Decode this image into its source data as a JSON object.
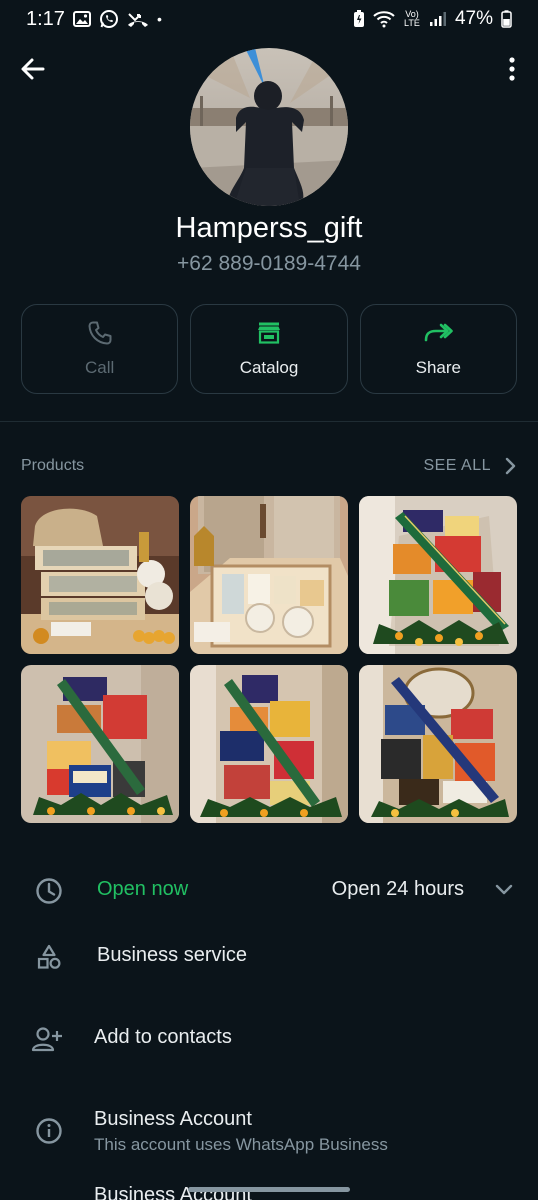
{
  "status_bar": {
    "time": "1:17",
    "dot": "•",
    "battery": "47%",
    "icons_left": [
      "gallery-icon",
      "whatsapp-icon",
      "missed-call-icon"
    ],
    "icons_right": [
      "battery-saver-icon",
      "wifi-icon",
      "volte-icon",
      "signal-icon",
      "battery-icon"
    ],
    "volte_text": "Vo) LTE"
  },
  "profile": {
    "name": "Hamperss_gift",
    "phone": "+62 889-0189-4744"
  },
  "actions": [
    {
      "label": "Call",
      "icon": "phone-icon",
      "enabled": false
    },
    {
      "label": "Catalog",
      "icon": "store-icon",
      "enabled": true
    },
    {
      "label": "Share",
      "icon": "share-icon",
      "enabled": true
    }
  ],
  "products": {
    "title": "Products",
    "see_all": "SEE ALL",
    "items": [
      {
        "image": "wooden-drawer-hamper"
      },
      {
        "image": "boxed-cup-set-hamper"
      },
      {
        "image": "snack-hamper-choco-ribbon"
      },
      {
        "image": "snack-hamper-foxs"
      },
      {
        "image": "snack-hamper-royal-tango"
      },
      {
        "image": "snack-hamper-tin-tango"
      }
    ]
  },
  "info": {
    "open_now": "Open now",
    "hours": "Open 24 hours",
    "business_service": "Business service",
    "add_contacts": "Add to contacts",
    "business_account_title": "Business Account",
    "business_account_sub": "This account uses WhatsApp Business",
    "partial_row": "Business Account"
  },
  "colors": {
    "background": "#0b141a",
    "accent_green": "#21c063",
    "muted": "#8696a0",
    "border": "#2a3942"
  }
}
